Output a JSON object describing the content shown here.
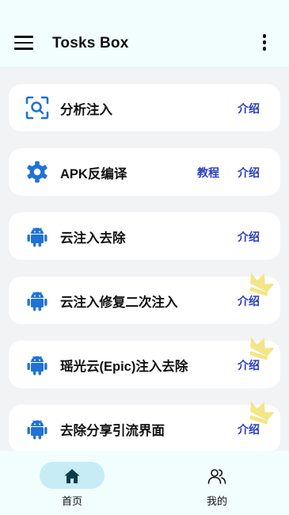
{
  "app": {
    "title": "Tosks Box"
  },
  "items": [
    {
      "icon": "scan-search-icon",
      "label": "分析注入",
      "links": [
        "介绍"
      ]
    },
    {
      "icon": "gear-icon",
      "label": "APK反编译",
      "links": [
        "教程",
        "介绍"
      ]
    },
    {
      "icon": "android-icon",
      "label": "云注入去除",
      "links": [
        "介绍"
      ]
    },
    {
      "icon": "android-icon",
      "label": "云注入修复二次注入",
      "links": [
        "介绍"
      ],
      "badge": "crown-icon"
    },
    {
      "icon": "android-icon",
      "label": "瑶光云(Epic)注入去除",
      "links": [
        "介绍"
      ],
      "badge": "crown-icon"
    },
    {
      "icon": "android-icon",
      "label": "去除分享引流界面",
      "links": [
        "介绍"
      ],
      "badge": "crown-icon"
    }
  ],
  "nav": [
    {
      "label": "首页",
      "icon": "home-icon",
      "active": true
    },
    {
      "label": "我的",
      "icon": "people-icon",
      "active": false
    }
  ],
  "colors": {
    "accent": "#1f72d6",
    "link": "#2a3fc2",
    "crown": "#f3e27a",
    "active_pill": "#c8ecf6"
  }
}
